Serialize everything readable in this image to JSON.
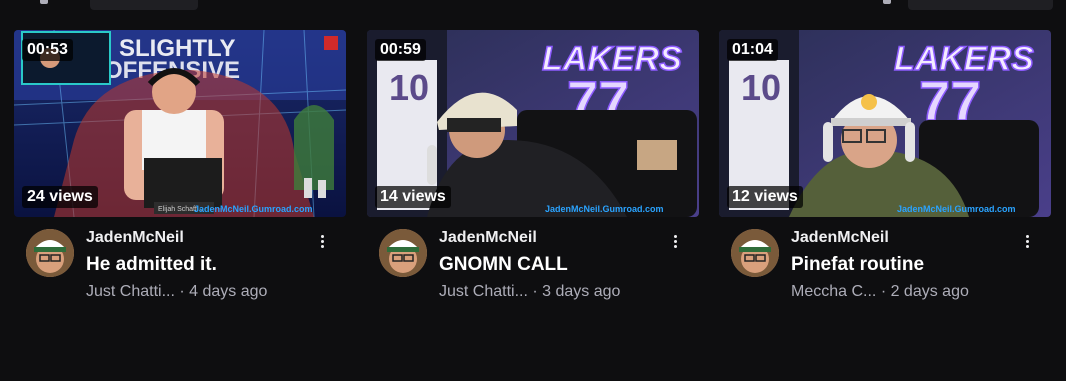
{
  "videos": [
    {
      "duration": "00:53",
      "views": "24 views",
      "channel": "JadenMcNeil",
      "title": "He admitted it.",
      "category": "Just Chatti...",
      "age": "· 4 days ago",
      "watermark": "JadenMcNeil.Gumroad.com",
      "backdrop_text_1": "SLIGHTLY",
      "backdrop_text_2": "OFFENSIVE",
      "nameplate": "Elijah Schaff..."
    },
    {
      "duration": "00:59",
      "views": "14 views",
      "channel": "JadenMcNeil",
      "title": "GNOMN CALL",
      "category": "Just Chatti...",
      "age": "· 3 days ago",
      "watermark": "JadenMcNeil.Gumroad.com",
      "sign_text": "LAKERS",
      "sign_number": "77",
      "jersey_number": "10"
    },
    {
      "duration": "01:04",
      "views": "12 views",
      "channel": "JadenMcNeil",
      "title": "Pinefat routine",
      "category": "Meccha C...",
      "age": "· 2 days ago",
      "watermark": "JadenMcNeil.Gumroad.com",
      "sign_text": "LAKERS",
      "sign_number": "77",
      "jersey_number": "10"
    }
  ],
  "colors": {
    "background": "#0e0e10",
    "text_primary": "#efeff1",
    "text_secondary": "#adadb8",
    "lakers_purple": "#6a3fc9",
    "watermark_blue": "#2aa3ff"
  }
}
